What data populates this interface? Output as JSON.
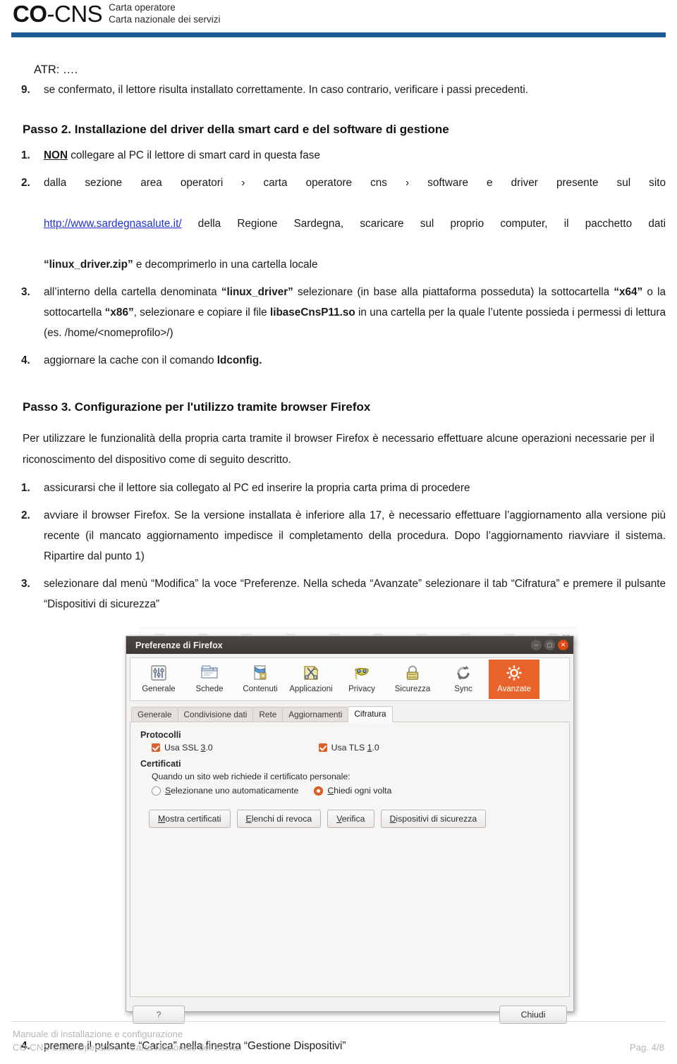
{
  "header": {
    "logo_bold": "CO",
    "logo_light": "-CNS",
    "subtitle_line1": "Carta operatore",
    "subtitle_line2": "Carta nazionale dei servizi",
    "rule_color": "#1f5b96"
  },
  "body": {
    "atr_line": "ATR: ….",
    "item9": {
      "num": "9.",
      "text": "se confermato, il lettore risulta installato correttamente. In caso contrario, verificare i passi precedenti."
    },
    "passo2_heading_prefix": "Passo 2.",
    "passo2_heading_rest": " Installazione del driver della smart card e del software di gestione",
    "passo2_items": [
      {
        "num": "1.",
        "parts": [
          {
            "t": "NON",
            "style": "bold-underline"
          },
          {
            "t": " collegare al PC il lettore di smart card in questa fase",
            "style": "normal"
          }
        ]
      },
      {
        "num": "2.",
        "line1": "dalla sezione     area operatori   ›   carta operatore cns   ›   software e driver   presente sul sito",
        "link_text": "http://www.sardegnasalute.it/",
        "line2_after_link": " della Regione Sardegna, scaricare sul proprio computer, il pacchetto dati",
        "line3_quote": "“linux_driver.zip”",
        "line3_rest": " e decomprimerlo in una cartella locale"
      },
      {
        "num": "3.",
        "seg1": "all’interno della cartella denominata ",
        "seg2_bold": "“linux_driver”",
        "seg3": " selezionare (in base alla piattaforma posseduta) la sottocartella ",
        "seg4_bold": "“x64”",
        "seg5": " o la sottocartella ",
        "seg6_bold": "“x86”",
        "seg7": ", selezionare e copiare il file ",
        "seg8_bold": "libaseCnsP11.so",
        "seg9": " in una cartella per la quale l’utente possieda i permessi di lettura (es. /home/<nomeprofilo>/)"
      },
      {
        "num": "4.",
        "seg1": "aggiornare la cache con il comando ",
        "seg2_bold": "ldconfig."
      }
    ],
    "passo3_heading_prefix": "Passo 3.",
    "passo3_heading_rest": " Configurazione per l'utilizzo tramite browser Firefox",
    "passo3_paragraph": "Per utilizzare le funzionalità della propria carta tramite il browser Firefox è necessario effettuare alcune operazioni necessarie per il riconoscimento del dispositivo come di seguito descritto.",
    "passo3_items": [
      {
        "num": "1.",
        "text": "assicurarsi che il lettore sia collegato al PC ed inserire la propria carta prima di procedere"
      },
      {
        "num": "2.",
        "text": "avviare il browser Firefox. Se la versione installata è inferiore alla 17, è necessario effettuare l’aggiornamento alla versione più recente (il mancato aggiornamento impedisce il completamento della procedura. Dopo l’aggiornamento riavviare il sistema. Ripartire dal punto 1)"
      },
      {
        "num": "3.",
        "text": "selezionare dal menù “Modifica” la voce “Preferenze. Nella scheda “Avanzate” selezionare il tab “Cifratura” e premere il pulsante “Dispositivi di sicurezza”"
      }
    ],
    "after_screenshot_item": {
      "num": "4.",
      "text": "premere il pulsante “Carica” nella finestra “Gestione Dispositivi”"
    }
  },
  "firefox_dialog": {
    "title": "Preferenze di Firefox",
    "window_buttons": [
      "minimize-icon",
      "maximize-icon",
      "close-icon"
    ],
    "accent_color": "#e8642a",
    "toolbar": [
      {
        "label": "Generale",
        "icon": "sliders-icon",
        "selected": false
      },
      {
        "label": "Schede",
        "icon": "tabs-window-icon",
        "selected": false
      },
      {
        "label": "Contenuti",
        "icon": "documents-icon",
        "selected": false
      },
      {
        "label": "Applicazioni",
        "icon": "scissors-page-icon",
        "selected": false
      },
      {
        "label": "Privacy",
        "icon": "mask-icon",
        "selected": false
      },
      {
        "label": "Sicurezza",
        "icon": "padlock-icon",
        "selected": false
      },
      {
        "label": "Sync",
        "icon": "sync-arrows-icon",
        "selected": false
      },
      {
        "label": "Avanzate",
        "icon": "gear-icon",
        "selected": true
      }
    ],
    "tabs": [
      {
        "label": "Generale",
        "active": false
      },
      {
        "label": "Condivisione dati",
        "active": false
      },
      {
        "label": "Rete",
        "active": false
      },
      {
        "label": "Aggiornamenti",
        "active": false
      },
      {
        "label": "Cifratura",
        "active": true
      }
    ],
    "protocolli": {
      "group_title": "Protocolli",
      "ssl": {
        "label_a": "Usa SSL ",
        "label_key": "3",
        "label_b": ".0",
        "checked": true
      },
      "tls": {
        "label_a": "Usa TLS ",
        "label_key": "1",
        "label_b": ".0",
        "checked": true
      }
    },
    "certificati": {
      "group_title": "Certificati",
      "question": "Quando un sito web richiede il certificato personale:",
      "option_auto": {
        "label_key": "S",
        "label_rest": "elezionane uno automaticamente",
        "selected": false
      },
      "option_ask": {
        "label_key": "C",
        "label_rest": "hiedi ogni volta",
        "selected": true
      },
      "buttons": [
        {
          "key": "M",
          "rest": "ostra certificati"
        },
        {
          "key": "E",
          "rest": "lenchi di revoca"
        },
        {
          "key": "V",
          "rest": "erifica"
        },
        {
          "key": "D",
          "rest": "ispositivi di sicurezza"
        }
      ]
    },
    "footer": {
      "help_label": "?",
      "close_label": "Chiudi"
    }
  },
  "footer": {
    "line1": "Manuale di installazione e configurazione",
    "line2": "CO-CNS Carta Operatore – Carta Nazionale dei Servizi",
    "page": "Pag. 4/8"
  }
}
